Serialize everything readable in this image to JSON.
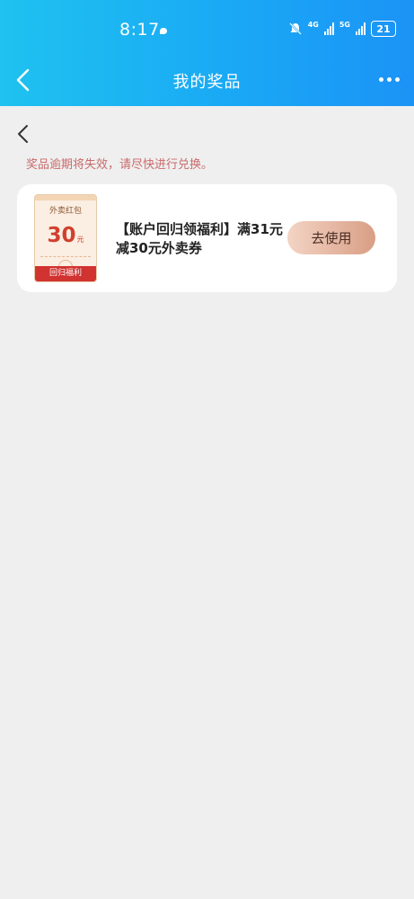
{
  "status_bar": {
    "time": "8:17",
    "network_1": "4G",
    "network_2": "5G",
    "battery": "21"
  },
  "header": {
    "title": "我的奖品"
  },
  "notice": "奖品逾期将失效，请尽快进行兑换。",
  "prizes": [
    {
      "ticket_header": "外卖红包",
      "amount": "30",
      "unit": "元",
      "ticket_footer": "回归福利",
      "title": "【账户回归领福利】满31元减30元外卖券",
      "action_label": "去使用"
    }
  ],
  "colors": {
    "header_start": "#1fc2f0",
    "header_end": "#1b93f6",
    "background": "#efefef",
    "notice": "#c96a6a",
    "amount": "#d0402f",
    "ticket_footer": "#d03330",
    "button_start": "#f3d4c4",
    "button_end": "#d99e85"
  },
  "icons": {
    "header_back": "chevron-left-icon",
    "more": "more-icon",
    "page_back": "chevron-left-icon",
    "notification": "bell-off-icon"
  }
}
